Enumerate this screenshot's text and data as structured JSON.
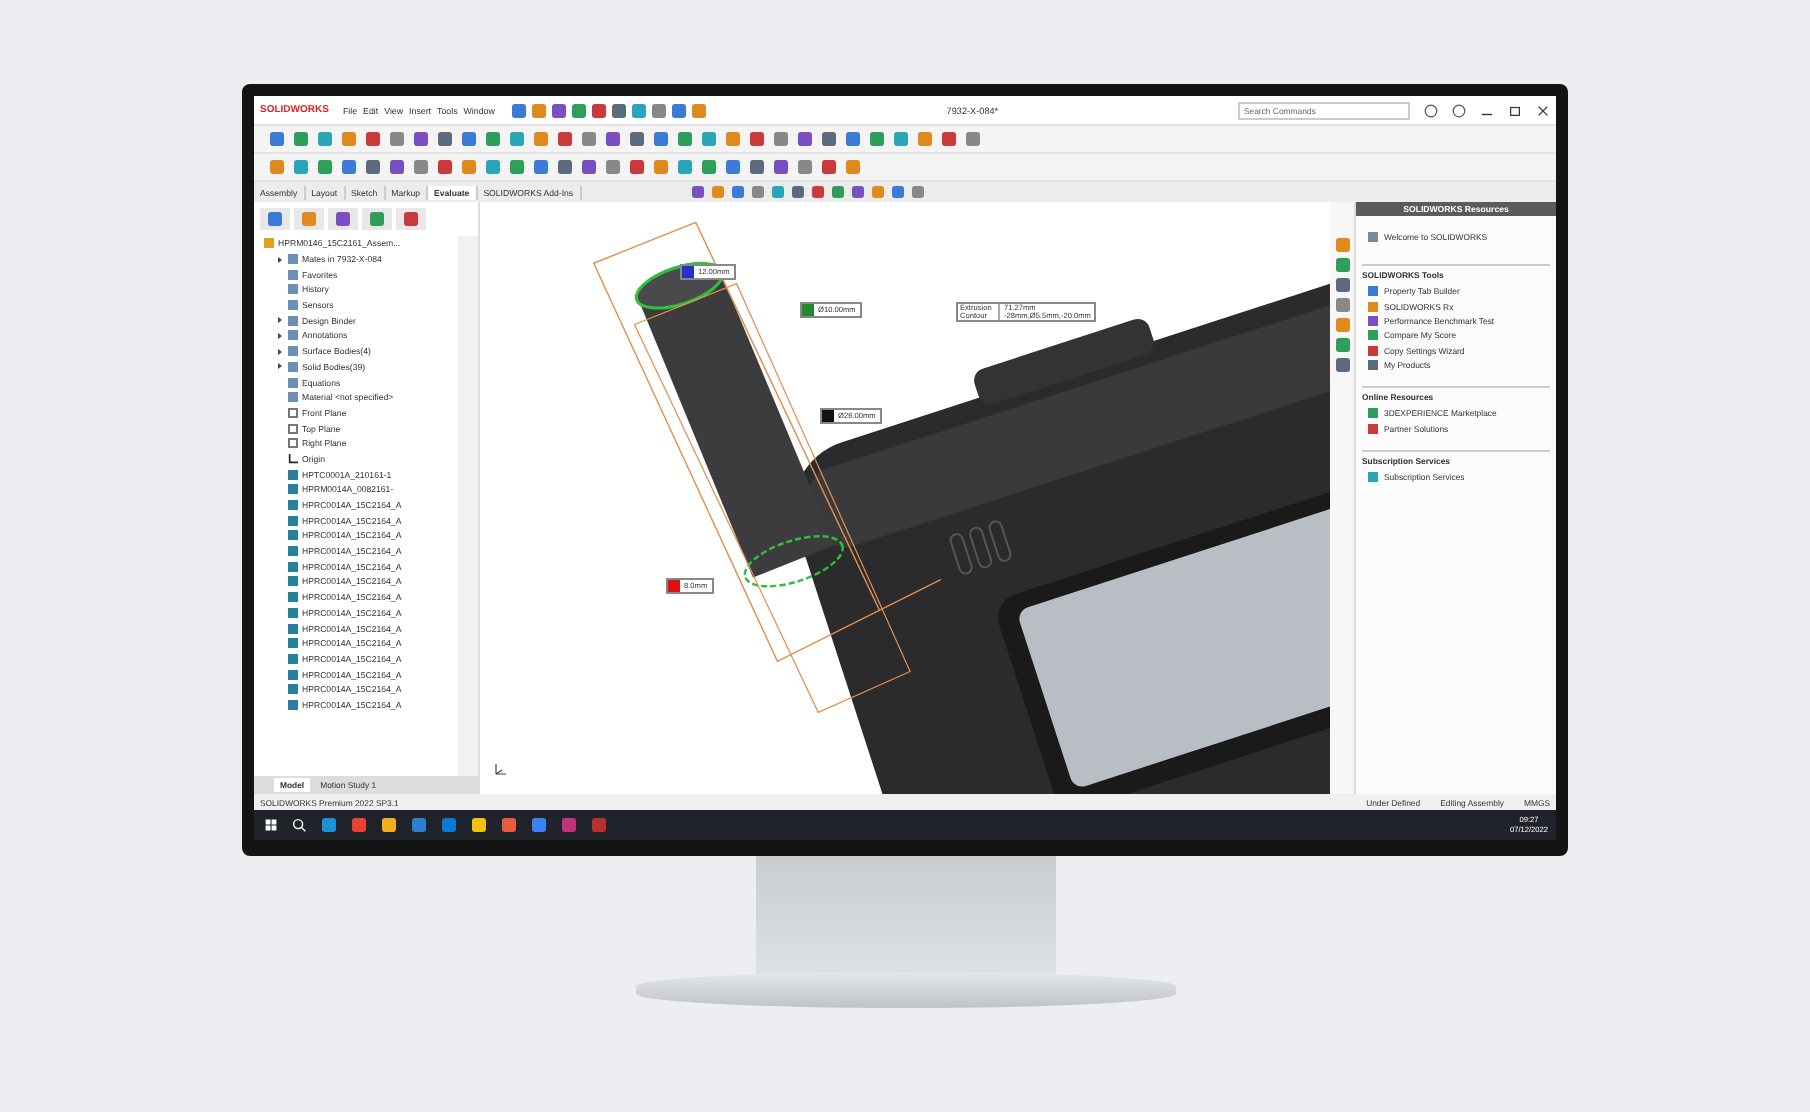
{
  "title_bar": {
    "logo": "SOLIDWORKS",
    "menu": [
      "File",
      "Edit",
      "View",
      "Insert",
      "Tools",
      "Window"
    ],
    "document_title": "7932-X-084*",
    "search": {
      "placeholder": "Search Commands"
    }
  },
  "command_tabs": [
    {
      "label": "Assembly",
      "selected": false
    },
    {
      "label": "Layout",
      "selected": false
    },
    {
      "label": "Sketch",
      "selected": false
    },
    {
      "label": "Markup",
      "selected": false
    },
    {
      "label": "Evaluate",
      "selected": true
    },
    {
      "label": "SOLIDWORKS Add-Ins",
      "selected": false
    }
  ],
  "feature_tree": {
    "root": "HPRM0146_15C2161_Assem...",
    "items": [
      {
        "label": "Mates in 7932-X-084",
        "kind": "folder",
        "collapsed": true
      },
      {
        "label": "Favorites",
        "kind": "folder",
        "collapsed": false
      },
      {
        "label": "History",
        "kind": "folder",
        "collapsed": false
      },
      {
        "label": "Sensors",
        "kind": "folder",
        "collapsed": false
      },
      {
        "label": "Design Binder",
        "kind": "folder",
        "collapsed": true
      },
      {
        "label": "Annotations",
        "kind": "folder",
        "collapsed": true
      },
      {
        "label": "Surface Bodies(4)",
        "kind": "folder",
        "collapsed": true
      },
      {
        "label": "Solid Bodies(39)",
        "kind": "folder",
        "collapsed": true
      },
      {
        "label": "Equations",
        "kind": "folder",
        "collapsed": false
      },
      {
        "label": "Material <not specified>",
        "kind": "folder",
        "collapsed": false
      },
      {
        "label": "Front Plane",
        "kind": "plane",
        "collapsed": false
      },
      {
        "label": "Top Plane",
        "kind": "plane",
        "collapsed": false
      },
      {
        "label": "Right Plane",
        "kind": "plane",
        "collapsed": false
      },
      {
        "label": "Origin",
        "kind": "origin",
        "collapsed": false
      },
      {
        "label": "HPTC0001A_210161-1",
        "kind": "part",
        "collapsed": false
      },
      {
        "label": "HPRM0014A_0082161-",
        "kind": "part",
        "collapsed": false
      },
      {
        "label": "HPRC0014A_15C2164_A",
        "kind": "part",
        "collapsed": false
      },
      {
        "label": "HPRC0014A_15C2164_A",
        "kind": "part",
        "collapsed": false
      },
      {
        "label": "HPRC0014A_15C2164_A",
        "kind": "part",
        "collapsed": false
      },
      {
        "label": "HPRC0014A_15C2164_A",
        "kind": "part",
        "collapsed": false
      },
      {
        "label": "HPRC0014A_15C2164_A",
        "kind": "part",
        "collapsed": false
      },
      {
        "label": "HPRC0014A_15C2164_A",
        "kind": "part",
        "collapsed": false
      },
      {
        "label": "HPRC0014A_15C2164_A",
        "kind": "part",
        "collapsed": false
      },
      {
        "label": "HPRC0014A_15C2164_A",
        "kind": "part",
        "collapsed": false
      },
      {
        "label": "HPRC0014A_15C2164_A",
        "kind": "part",
        "collapsed": false
      },
      {
        "label": "HPRC0014A_15C2164_A",
        "kind": "part",
        "collapsed": false
      },
      {
        "label": "HPRC0014A_15C2164_A",
        "kind": "part",
        "collapsed": false
      },
      {
        "label": "HPRC0014A_15C2164_A",
        "kind": "part",
        "collapsed": false
      },
      {
        "label": "HPRC0014A_15C2164_A",
        "kind": "part",
        "collapsed": false
      },
      {
        "label": "HPRC0014A_15C2164_A",
        "kind": "part",
        "collapsed": false
      }
    ]
  },
  "tree_tabs": [
    {
      "label": "Model",
      "selected": true
    },
    {
      "label": "Motion Study 1",
      "selected": false
    }
  ],
  "viewport": {
    "callouts": [
      {
        "color": "#2233cc",
        "text": "12.00mm"
      },
      {
        "color": "#22882e",
        "text": "Ø10.00mm"
      },
      {
        "color": "#111111",
        "text": "Ø26.00mm"
      },
      {
        "color": "#dd1111",
        "text": "8.0mm"
      }
    ],
    "info_box": [
      {
        "label": "Extrusion",
        "value": "71.27mm"
      },
      {
        "label": "Contour",
        "value": "-28mm,Ø5.5mm,-20.0mm"
      }
    ]
  },
  "task_pane": {
    "title": "SOLIDWORKS Resources",
    "welcome": "Welcome to SOLIDWORKS",
    "sections": [
      {
        "title": "SOLIDWORKS Tools",
        "items": [
          "Property Tab Builder",
          "SOLIDWORKS Rx",
          "Performance Benchmark Test",
          "Compare My Score",
          "Copy Settings Wizard",
          "My Products"
        ]
      },
      {
        "title": "Online Resources",
        "items": [
          "3DEXPERIENCE Marketplace",
          "Partner Solutions"
        ]
      },
      {
        "title": "Subscription Services",
        "items": [
          "Subscription Services"
        ]
      }
    ]
  },
  "status_bar": {
    "product": "SOLIDWORKS Premium 2022 SP3.1",
    "items": [
      "Under Defined",
      "Editing Assembly",
      "MMGS"
    ]
  },
  "taskbar": {
    "time": "09:27",
    "date": "07/12/2022"
  }
}
